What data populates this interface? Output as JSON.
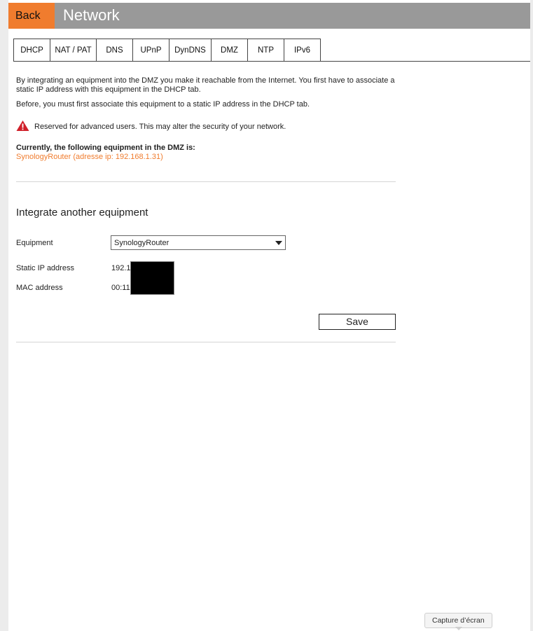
{
  "header": {
    "back_label": "Back",
    "title": "Network",
    "accent_color": "#f07c2e"
  },
  "tabs": [
    {
      "label": "DHCP",
      "active": false
    },
    {
      "label": "NAT / PAT",
      "active": false
    },
    {
      "label": "DNS",
      "active": false
    },
    {
      "label": "UPnP",
      "active": false
    },
    {
      "label": "DynDNS",
      "active": false
    },
    {
      "label": "DMZ",
      "active": true
    },
    {
      "label": "NTP",
      "active": false
    },
    {
      "label": "IPv6",
      "active": false
    }
  ],
  "intro": {
    "line1": "By integrating an equipment into the DMZ you make it reachable from the Internet. You first have to associate a static IP address with this equipment in the DHCP tab.",
    "line2": "Before, you must first associate this equipment to a static IP address in the DHCP tab."
  },
  "warning": {
    "icon": "warning-triangle-icon",
    "text": "Reserved for advanced users. This may alter the security of your network."
  },
  "current": {
    "label": "Currently, the following equipment in the DMZ is:",
    "value": "SynologyRouter (adresse ip: 192.168.1.31)"
  },
  "integrate": {
    "title": "Integrate another equipment",
    "equipment_label": "Equipment",
    "equipment_selected": "SynologyRouter",
    "static_ip_label": "Static IP address",
    "static_ip_value": "192.1",
    "mac_label": "MAC address",
    "mac_value": "00:11",
    "save_label": "Save"
  },
  "tooltip": {
    "text": "Capture d’écran"
  }
}
